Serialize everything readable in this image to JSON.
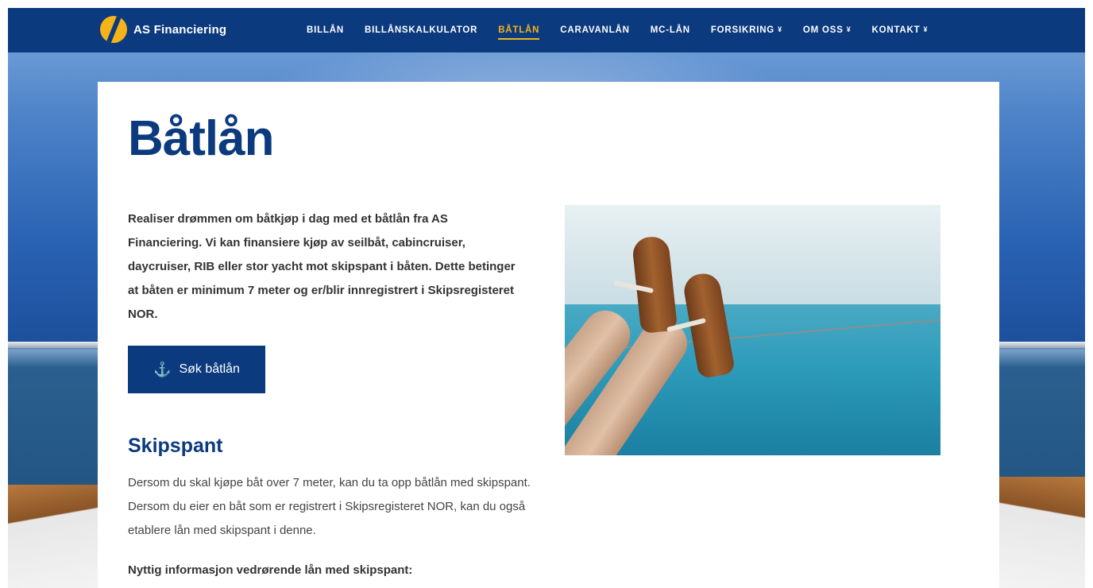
{
  "brand": {
    "name": "AS Financiering"
  },
  "nav": {
    "items": [
      {
        "label": "BILLÅN",
        "active": false,
        "has_dropdown": false
      },
      {
        "label": "BILLÅNSKALKULATOR",
        "active": false,
        "has_dropdown": false
      },
      {
        "label": "BÅTLÅN",
        "active": true,
        "has_dropdown": false
      },
      {
        "label": "CARAVANLÅN",
        "active": false,
        "has_dropdown": false
      },
      {
        "label": "MC-LÅN",
        "active": false,
        "has_dropdown": false
      },
      {
        "label": "FORSIKRING",
        "active": false,
        "has_dropdown": true
      },
      {
        "label": "OM OSS",
        "active": false,
        "has_dropdown": true
      },
      {
        "label": "KONTAKT",
        "active": false,
        "has_dropdown": true
      }
    ]
  },
  "main": {
    "title": "Båtlån",
    "intro": "Realiser drømmen om båtkjøp i dag med et båtlån fra AS Financiering. Vi kan finansiere kjøp av seilbåt, cabincruiser, daycruiser, RIB eller stor yacht mot skipspant i båten. Dette betinger at båten er minimum 7 meter og er/blir innregistrert i Skipsregisteret NOR.",
    "apply_button": "Søk båtlån",
    "section_title": "Skipspant",
    "section_body": "Dersom du skal kjøpe båt over 7 meter, kan du ta opp båtlån med skipspant. Dersom du eier en båt som er registrert i Skipsregisteret NOR, kan du også etablere lån med skipspant i denne.",
    "useful_info": "Nyttig informasjon vedrørende lån med skipspant:"
  },
  "icons": {
    "apply": "anchor-icon",
    "dropdown": "chevron-down-icon"
  },
  "colors": {
    "primary": "#0b3a7e",
    "accent": "#f5b31a",
    "text": "#333333"
  }
}
